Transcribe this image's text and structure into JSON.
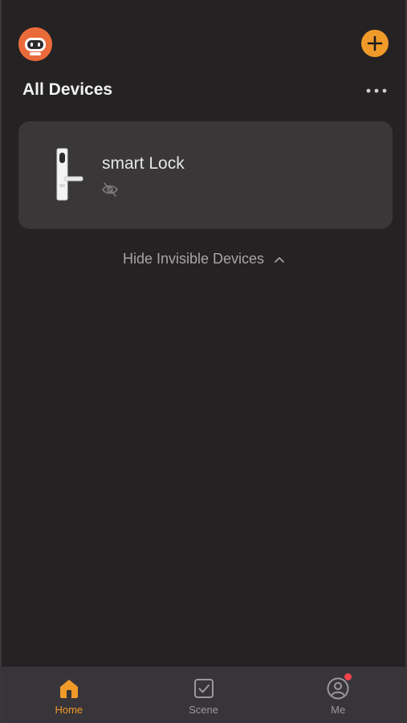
{
  "header": {
    "avatar_icon": "robot-avatar-icon",
    "add_icon": "plus-icon",
    "title": "All Devices",
    "more_icon": "more-dots-icon"
  },
  "devices": [
    {
      "name": "smart Lock",
      "image": "smart-lock-image",
      "status_icon": "eye-off-icon"
    }
  ],
  "toggle": {
    "label": "Hide Invisible Devices",
    "icon": "chevron-up-icon"
  },
  "tabbar": {
    "items": [
      {
        "label": "Home",
        "icon": "home-icon",
        "active": true
      },
      {
        "label": "Scene",
        "icon": "scene-check-icon",
        "active": false
      },
      {
        "label": "Me",
        "icon": "profile-icon",
        "active": false,
        "badge": true
      }
    ]
  },
  "colors": {
    "accent": "#f09a2a",
    "background": "#252223",
    "card": "#3a3738",
    "badge": "#f2424a"
  }
}
